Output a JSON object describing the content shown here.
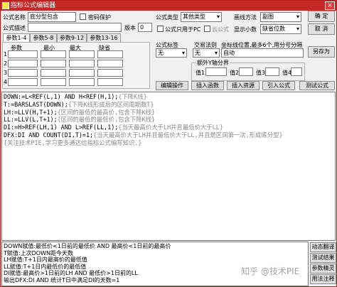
{
  "window": {
    "title": "指标公式编辑器",
    "close": "×"
  },
  "form": {
    "name_label": "公式名称",
    "name_value": "底分型包含",
    "password_label": "密码保护",
    "desc_label": "公式描述",
    "version_label": "版本",
    "version_value": "0",
    "type_label": "公式类型",
    "type_value": "其他类型",
    "draw_label": "画线方法",
    "draw_value": "副图",
    "pc_only_label": "公式只用于PC",
    "cloud_label": "云公式",
    "decimals_label": "显示小数",
    "decimals_value": "缺省位数"
  },
  "tabs": [
    "参数1-4",
    "参数5-8",
    "参数9-12",
    "参数13-16"
  ],
  "param_headers": [
    "参数",
    "最小",
    "最大",
    "缺省"
  ],
  "param_rows": [
    "1",
    "2",
    "3",
    "4"
  ],
  "mid": {
    "formula_tag_label": "公式标签",
    "trade_rule_label": "交易法则",
    "coord_label": "坐标线位置,最多6个,用分号分隔",
    "tag_value": "无",
    "trade_value": "无",
    "coord_value": "自动",
    "yaxis_group": "额外Y轴分界",
    "y1_label": "值1",
    "y2_label": "值2",
    "y3_label": "值3",
    "y4_label": "值4"
  },
  "buttons": {
    "confirm": "确 定",
    "cancel": "取 消",
    "save_as": "另存为",
    "edit_op": "编辑操作",
    "insert_func": "插入函数",
    "insert_res": "插入资源",
    "import": "引入公式",
    "test": "测试公式"
  },
  "code_lines": [
    [
      {
        "t": "DOWN:=L<REF(L,1) AND H<REF(H,1);",
        "c": "kw"
      },
      {
        "t": "{下降K线}",
        "c": "cm"
      }
    ],
    [
      {
        "t": "T:=BARSLAST(DOWN);",
        "c": "kw"
      },
      {
        "t": "{下降K线形成后的区间周期数T}",
        "c": "cm"
      }
    ],
    [
      {
        "t": "LH:=LLV(H,T+1);",
        "c": "kw"
      },
      {
        "t": "{区间的最低的最高价,包含下降K线}",
        "c": "cm"
      }
    ],
    [
      {
        "t": "LL:=LLV(L,T+1);",
        "c": "kw"
      },
      {
        "t": "{区间的最低的最低价,包含下降K线}",
        "c": "cm"
      }
    ],
    [
      {
        "t": "DI:=H>REF(LH,1) AND L>REF(LL,1);",
        "c": "kw"
      },
      {
        "t": "{当天最高价大于LH并且最低价大于LL}",
        "c": "cm"
      }
    ],
    [
      {
        "t": "DFX:DI AND COUNT(DI,T)=1;",
        "c": "kw"
      },
      {
        "t": "{当天最高价大于LH并且最低价大于LL,并且是区间第一次,形成底分型}",
        "c": "cm"
      }
    ],
    [
      {
        "t": "{关注技术PIE,学习更多通达信指标公式编写知识.}",
        "c": "cm"
      }
    ]
  ],
  "output_lines": [
    "DOWN赋值:最低价<1日前的最低价 AND 最高价<1日前的最高价",
    "T赋值:上次DOWN距今天数",
    "LH赋值:T+1日内最高价的最低值",
    "LL赋值:T+1日内最低价的最低值",
    "DI赋值:最高价>1日前的LH AND 最低价>1日前的LL",
    "输出DFX:DI AND 统计T日中满足DI的天数=1"
  ],
  "side_buttons": [
    "动态翻译",
    "测试结果",
    "参数精灵",
    "用法注释"
  ],
  "watermark": "知乎 @技术PIE"
}
